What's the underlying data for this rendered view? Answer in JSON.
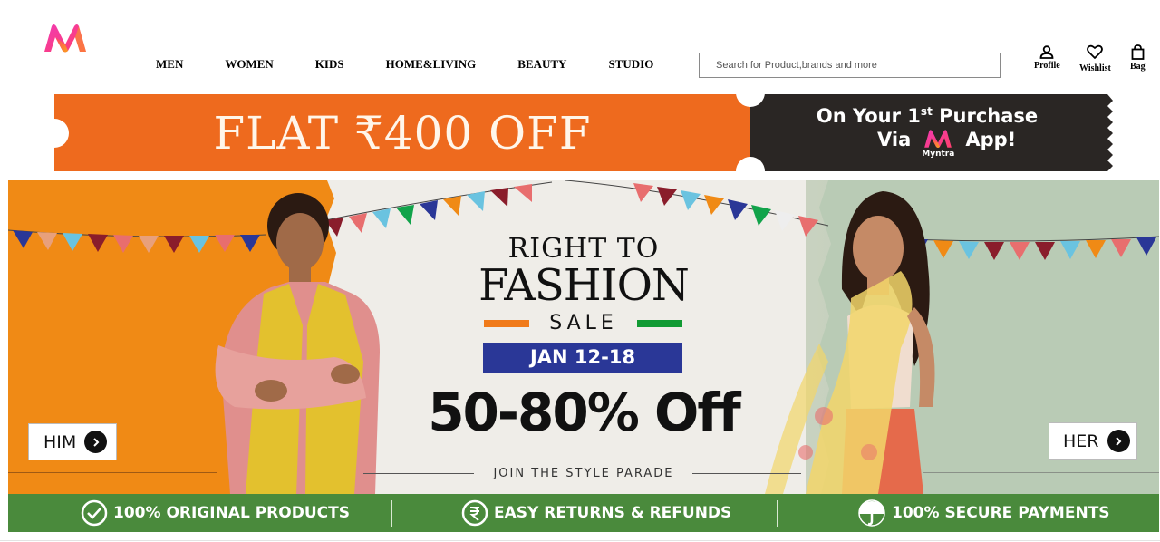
{
  "brand": {
    "logo_icon": "myntra-logo-icon"
  },
  "nav": {
    "items": [
      "MEN",
      "WOMEN",
      "KIDS",
      "HOME&LIVING",
      "BEAUTY",
      "STUDIO"
    ]
  },
  "search": {
    "placeholder": "Search for Product,brands and more"
  },
  "actions": {
    "profile_label": "Profile",
    "wishlist_label": "Wishlist",
    "bag_label": "Bag"
  },
  "coupon": {
    "left_text": "FLAT ₹400 OFF",
    "right_line1_pre": "On Your 1",
    "right_line1_sup": "st",
    "right_line1_post": " Purchase",
    "right_line2_pre": "Via",
    "right_line2_post": "App!",
    "brand_name": "Myntra",
    "colors": {
      "left": "#ee6a1e",
      "right": "#2a2624"
    }
  },
  "hero": {
    "title_line1": "RIGHT TO",
    "title_line2": "FASHION",
    "title_line3": "SALE",
    "dates": "JAN 12-18",
    "discount": "50-80% Off",
    "tagline": "JOIN THE STYLE PARADE",
    "cta_him": "HIM",
    "cta_her": "HER",
    "colors": {
      "orange": "#f08a15",
      "blue": "#2a3797",
      "green": "#119a33"
    }
  },
  "trust": {
    "items": [
      {
        "label": "100% ORIGINAL PRODUCTS",
        "icon": "check-circle-icon"
      },
      {
        "label": "EASY RETURNS & REFUNDS",
        "icon": "rupee-circle-icon"
      },
      {
        "label": "100% SECURE PAYMENTS",
        "icon": "umbrella-shield-icon"
      }
    ],
    "color": "#4a8a3c"
  }
}
